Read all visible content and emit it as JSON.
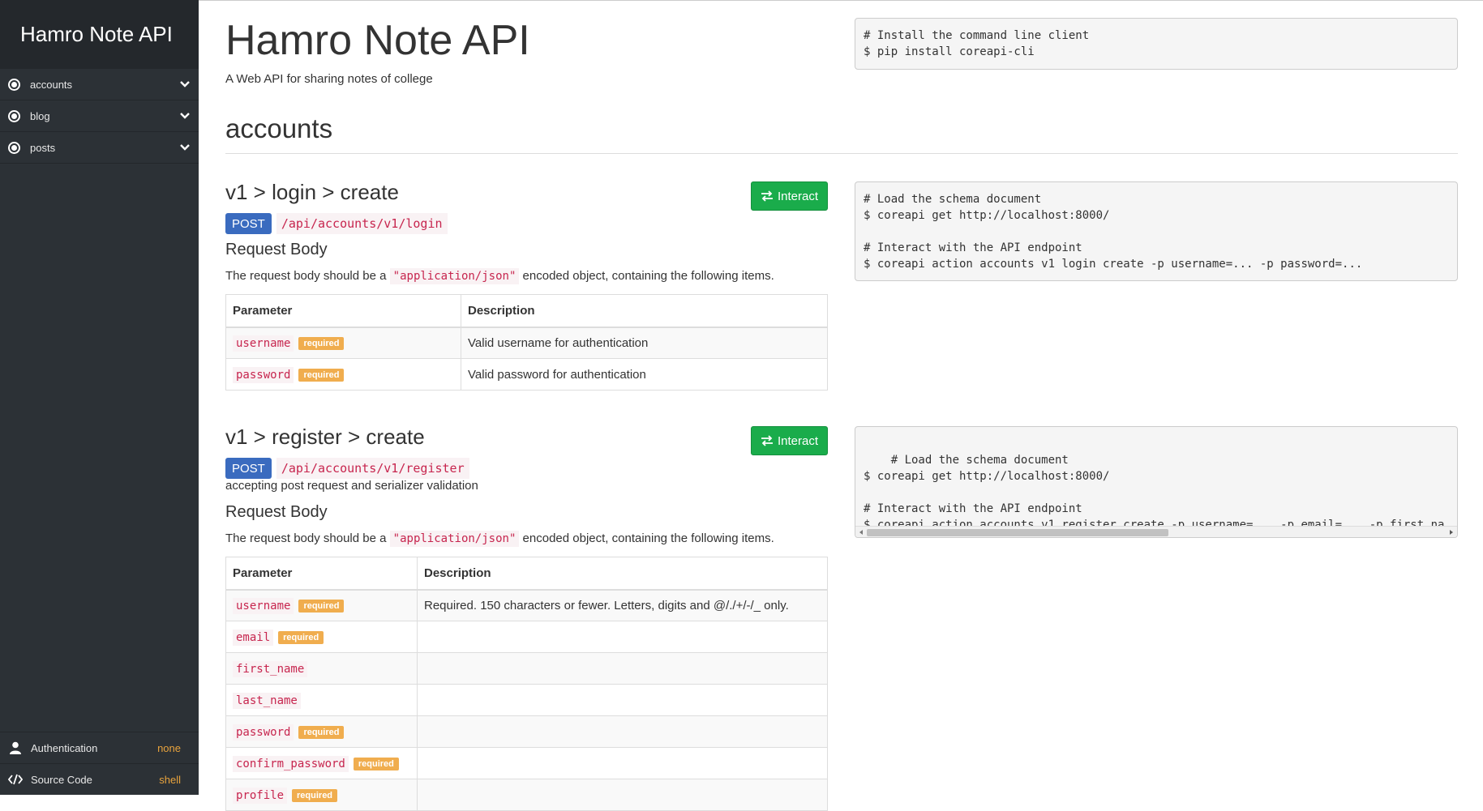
{
  "sidebar": {
    "brand": "Hamro Note API",
    "items": [
      {
        "label": "accounts"
      },
      {
        "label": "blog"
      },
      {
        "label": "posts"
      }
    ],
    "bottom": [
      {
        "label": "Authentication",
        "value": "none",
        "icon": "user-icon"
      },
      {
        "label": "Source Code",
        "value": "shell",
        "icon": "code-icon"
      }
    ]
  },
  "main": {
    "title": "Hamro Note API",
    "description": "A Web API for sharing notes of college",
    "install_code": "# Install the command line client\n$ pip install coreapi-cli",
    "section_title": "accounts",
    "endpoints": [
      {
        "title": "v1 > login > create",
        "method": "POST",
        "url": "/api/accounts/v1/login",
        "interact_label": "Interact",
        "request_body_title": "Request Body",
        "rb_prefix": "The request body should be a",
        "rb_type": "\"application/json\"",
        "rb_suffix": "encoded object, containing the following items.",
        "col_param": "Parameter",
        "col_desc": "Description",
        "params": [
          {
            "name": "username",
            "required": "required",
            "desc": "Valid username for authentication"
          },
          {
            "name": "password",
            "required": "required",
            "desc": "Valid password for authentication"
          }
        ],
        "code": "# Load the schema document\n$ coreapi get http://localhost:8000/\n\n# Interact with the API endpoint\n$ coreapi action accounts v1 login create -p username=... -p password=..."
      },
      {
        "title": "v1 > register > create",
        "method": "POST",
        "url": "/api/accounts/v1/register",
        "note": "accepting post request and serializer validation",
        "interact_label": "Interact",
        "request_body_title": "Request Body",
        "rb_prefix": "The request body should be a",
        "rb_type": "\"application/json\"",
        "rb_suffix": "encoded object, containing the following items.",
        "col_param": "Parameter",
        "col_desc": "Description",
        "params": [
          {
            "name": "username",
            "required": "required",
            "desc": "Required. 150 characters or fewer. Letters, digits and @/./+/-/_ only."
          },
          {
            "name": "email",
            "required": "required",
            "desc": ""
          },
          {
            "name": "first_name",
            "required": "",
            "desc": ""
          },
          {
            "name": "last_name",
            "required": "",
            "desc": ""
          },
          {
            "name": "password",
            "required": "required",
            "desc": ""
          },
          {
            "name": "confirm_password",
            "required": "required",
            "desc": ""
          },
          {
            "name": "profile",
            "required": "required",
            "desc": ""
          }
        ],
        "code": "# Load the schema document\n$ coreapi get http://localhost:8000/\n\n# Interact with the API endpoint\n$ coreapi action accounts v1 register create -p username=... -p email=... -p first_na"
      }
    ]
  },
  "colors": {
    "sidebar_bg": "#2c3136",
    "brand_bg": "#24282c",
    "post_badge": "#3a6bbf",
    "interact_button": "#1aac4b",
    "required_badge": "#f0ad4e",
    "code_text": "#c7254e",
    "accent_value": "#e8a33d"
  }
}
